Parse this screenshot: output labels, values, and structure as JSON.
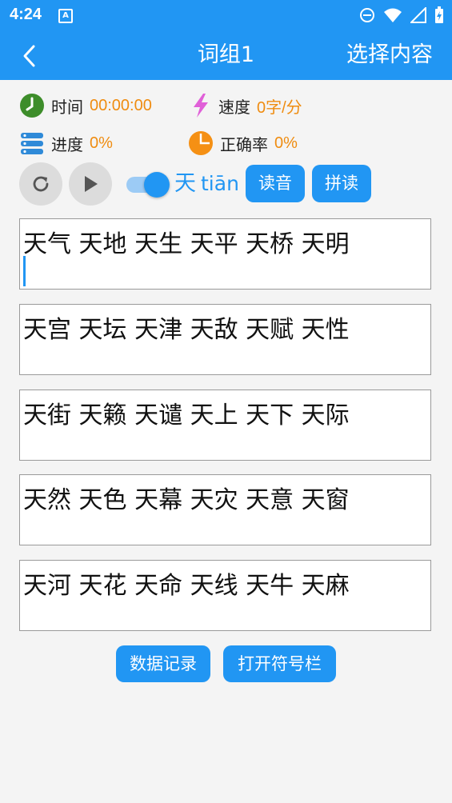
{
  "status_bar": {
    "time": "4:24",
    "notification_letter": "A"
  },
  "app_bar": {
    "title": "词组1",
    "action_label": "选择内容"
  },
  "stats": {
    "time_label": "时间",
    "time_value": "00:00:00",
    "speed_label": "速度",
    "speed_value": "0字/分",
    "progress_label": "进度",
    "progress_value": "0%",
    "accuracy_label": "正确率",
    "accuracy_value": "0%"
  },
  "controls": {
    "current_char": "天",
    "current_pinyin": "tiān",
    "read_button": "读音",
    "spell_button": "拼读",
    "pinyin_toggle_on": true
  },
  "word_groups": [
    "天气 天地 天生 天平 天桥 天明",
    "天宫 天坛 天津 天敌 天赋 天性",
    "天街 天籁 天谴 天上 天下 天际",
    "天然 天色 天幕 天灾 天意 天窗",
    "天河 天花 天命 天线 天牛 天麻"
  ],
  "bottom_buttons": {
    "records": "数据记录",
    "symbols": "打开符号栏"
  },
  "colors": {
    "primary": "#2196f3",
    "accent_value": "#ef8c10",
    "background": "#f4f4f4"
  }
}
